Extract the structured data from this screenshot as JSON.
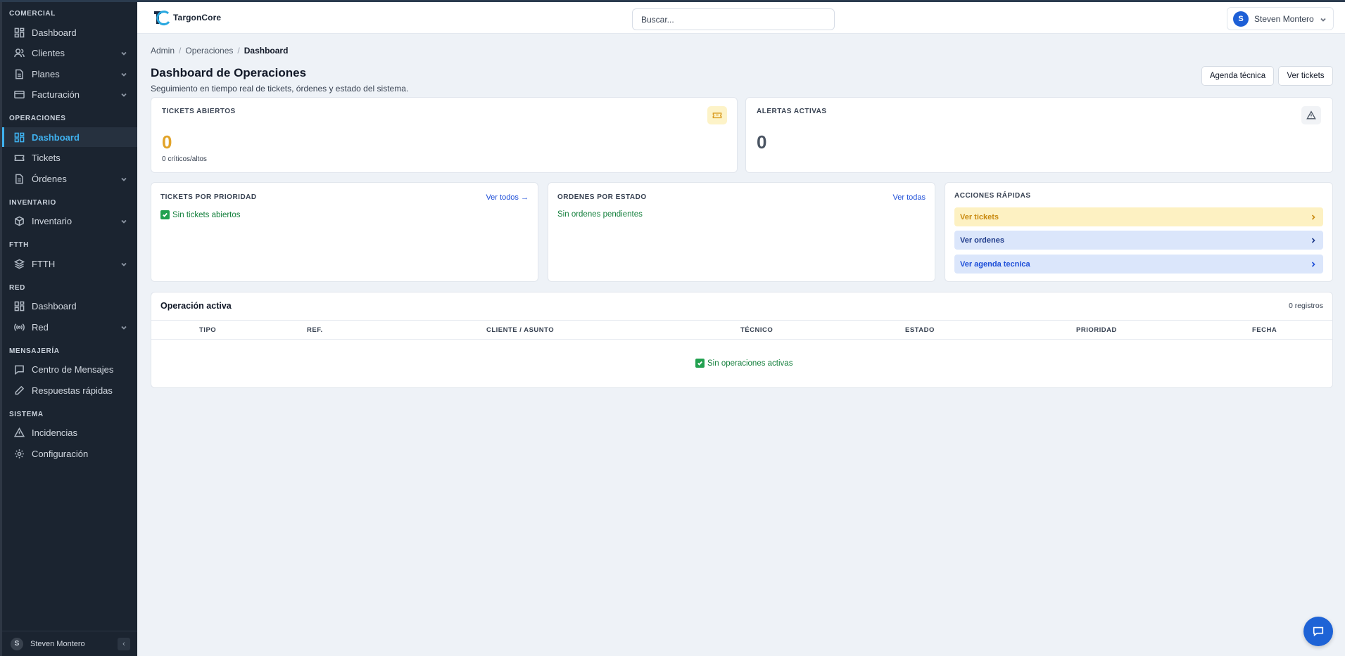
{
  "sidebar": {
    "sections": {
      "comercial": "COMERCIAL",
      "operaciones": "OPERACIONES",
      "inventario": "INVENTARIO",
      "ftth": "FTTH",
      "red": "RED",
      "mensajeria": "MENSAJERÍA",
      "sistema": "SISTEMA"
    },
    "items": [
      {
        "label": "Dashboard",
        "icon": "dashboard-icon"
      },
      {
        "label": "Clientes",
        "icon": "users-icon"
      },
      {
        "label": "Planes",
        "icon": "document-icon"
      },
      {
        "label": "Facturación",
        "icon": "credit-card-icon"
      },
      {
        "label": "Dashboard",
        "icon": "dashboard-icon"
      },
      {
        "label": "Tickets",
        "icon": "ticket-icon"
      },
      {
        "label": "Órdenes",
        "icon": "document-icon"
      },
      {
        "label": "Inventario",
        "icon": "box-icon"
      },
      {
        "label": "FTTH",
        "icon": "layers-icon"
      },
      {
        "label": "Dashboard",
        "icon": "dashboard-icon"
      },
      {
        "label": "Red",
        "icon": "signal-icon"
      },
      {
        "label": "Centro de Mensajes",
        "icon": "message-icon"
      },
      {
        "label": "Respuestas rápidas",
        "icon": "pen-icon"
      },
      {
        "label": "Incidencias",
        "icon": "warning-icon"
      },
      {
        "label": "Configuración",
        "icon": "gear-icon"
      }
    ],
    "footer_avatar": "S",
    "footer_user": "Steven Montero",
    "collapse_glyph": "‹"
  },
  "header": {
    "brand": "TargonCore",
    "search_placeholder": "Buscar...",
    "user_initial": "S",
    "user_name": "Steven Montero"
  },
  "breadcrumb": {
    "items": [
      "Admin",
      "Operaciones",
      "Dashboard"
    ],
    "separator": "/"
  },
  "page": {
    "title": "Dashboard de Operaciones",
    "subtitle": "Seguimiento en tiempo real de tickets, órdenes y estado del sistema.",
    "btn_agenda": "Agenda técnica",
    "btn_tickets": "Ver tickets"
  },
  "stats": {
    "tickets_label": "TICKETS ABIERTOS",
    "tickets_value": "0",
    "tickets_sub": "0 críticos/altos",
    "alerts_label": "ALERTAS ACTIVAS",
    "alerts_value": "0"
  },
  "panels": {
    "priority_label": "TICKETS POR PRIORIDAD",
    "priority_link": "Ver todos →",
    "priority_empty": "Sin tickets abiertos",
    "orders_label": "ORDENES POR ESTADO",
    "orders_link": "Ver todas",
    "orders_empty": "Sin ordenes pendientes",
    "quick_label": "ACCIONES RÁPIDAS",
    "quick_actions": [
      "Ver tickets",
      "Ver ordenes",
      "Ver agenda tecnica"
    ]
  },
  "table": {
    "title": "Operación activa",
    "count": "0 registros",
    "columns": [
      "TIPO",
      "REF.",
      "CLIENTE / ASUNTO",
      "TÉCNICO",
      "ESTADO",
      "PRIORIDAD",
      "FECHA"
    ],
    "empty": "Sin operaciones activas"
  },
  "colors": {
    "accent": "#3fb2f0",
    "sidebar_bg": "#1b2430",
    "ticket_number": "#e2a42a",
    "alert_number": "#4b5563",
    "success": "#15803d",
    "link": "#1d4ed8"
  }
}
